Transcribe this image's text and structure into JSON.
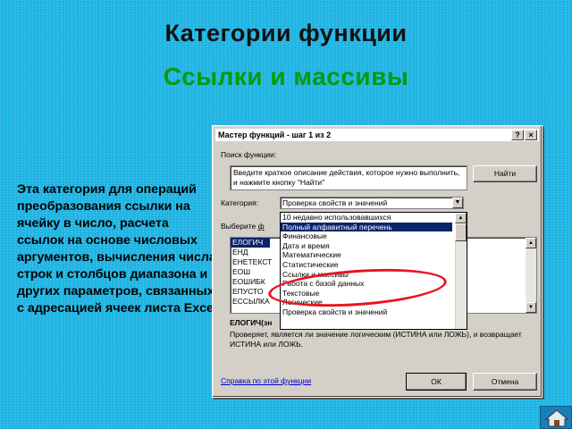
{
  "slide": {
    "title": "Категории функции",
    "subtitle": "Ссылки и массивы",
    "description": "Эта категория для операций преобразования ссылки на ячейку в число, расчета ссылок на основе числовых аргументов, вычисления числа строк и столбцов диапазона и других параметров, связанных с адресацией ячеек листа Excel"
  },
  "dialog": {
    "title": "Мастер функций - шаг 1 из 2",
    "help_btn": "?",
    "close_btn": "×",
    "search_label": "Поиск функции:",
    "search_value": "Введите краткое описание действия, которое нужно выполнить, и нажмите кнопку \"Найти\"",
    "find_btn": "Найти",
    "category_label": "Категория:",
    "category_value": "Проверка свойств и значений",
    "choose_label_pre": "Выберите ",
    "choose_label_u": "ф",
    "functions": [
      "ЕЛОГИЧ",
      "ЕНД",
      "ЕНЕТЕКСТ",
      "ЕОШ",
      "ЕОШИБК",
      "ЕПУСТО",
      "ЕССЫЛКА"
    ],
    "dropdown_items": [
      "10 недавно использовавшихся",
      "Полный алфавитный перечень",
      "Финансовые",
      "Дата и время",
      "Математические",
      "Статистические",
      "Ссылки и массивы",
      "Работа с базой данных",
      "Текстовые",
      "Логические",
      "Проверка свойств и значений"
    ],
    "func_signature": "ЕЛОГИЧ(зн",
    "func_description": "Проверяет, является ли значение логическим (ИСТИНА или ЛОЖЬ), и возвращает ИСТИНА или ЛОЖЬ.",
    "help_link": "Справка по этой функции",
    "ok_btn": "ОК",
    "cancel_btn": "Отмена"
  },
  "colors": {
    "background": "#22b8e6",
    "subtitle": "#0b9a0b",
    "highlight_ring": "#e8141e",
    "selection": "#0a246a"
  }
}
